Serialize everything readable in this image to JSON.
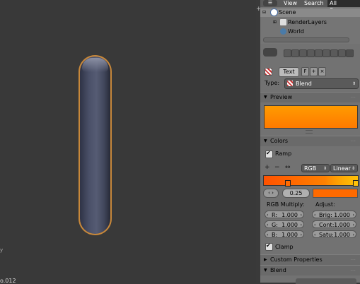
{
  "viewport": {
    "object_label": "o.012",
    "axis_label": "y",
    "capsule_color": "#4a5068",
    "selection_color": "#c8883a"
  },
  "outliner": {
    "header": {
      "view": "View",
      "search": "Search",
      "display_mode": "All Scenes"
    },
    "tree": [
      {
        "label": "Scene",
        "icon": "scene-icon"
      },
      {
        "label": "RenderLayers",
        "icon": "render-layers-icon"
      },
      {
        "label": "World",
        "icon": "world-icon"
      }
    ]
  },
  "properties": {
    "texture": {
      "name": "Text",
      "fake_user": "F",
      "add": "+",
      "unlink": "×",
      "type_label": "Type:",
      "type_value": "Blend"
    },
    "panels": {
      "preview": "Preview",
      "colors": "Colors",
      "custom_properties": "Custom Properties",
      "blend": "Blend"
    },
    "colors": {
      "ramp_label": "Ramp",
      "ramp_checked": true,
      "tools": {
        "add": "+",
        "remove": "−",
        "flip": "↔"
      },
      "color_mode": "RGB",
      "interpolation": "Linear",
      "stop_position": "0.25",
      "stop_color": "#ff6a00",
      "rgb_multiply_label": "RGB Multiply:",
      "adjust_label": "Adjust:",
      "rgb": [
        {
          "key": "R:",
          "value": "1.000"
        },
        {
          "key": "G:",
          "value": "1.000"
        },
        {
          "key": "B:",
          "value": "1.000"
        }
      ],
      "adjust": [
        {
          "key": "Brig:",
          "value": "1.000"
        },
        {
          "key": "Cont:",
          "value": "1.000"
        },
        {
          "key": "Satu:",
          "value": "1.000"
        }
      ],
      "clamp_label": "Clamp",
      "clamp_checked": true
    },
    "preview_colors": {
      "top": "#ff9b00",
      "bottom": "#ff7a00"
    }
  }
}
